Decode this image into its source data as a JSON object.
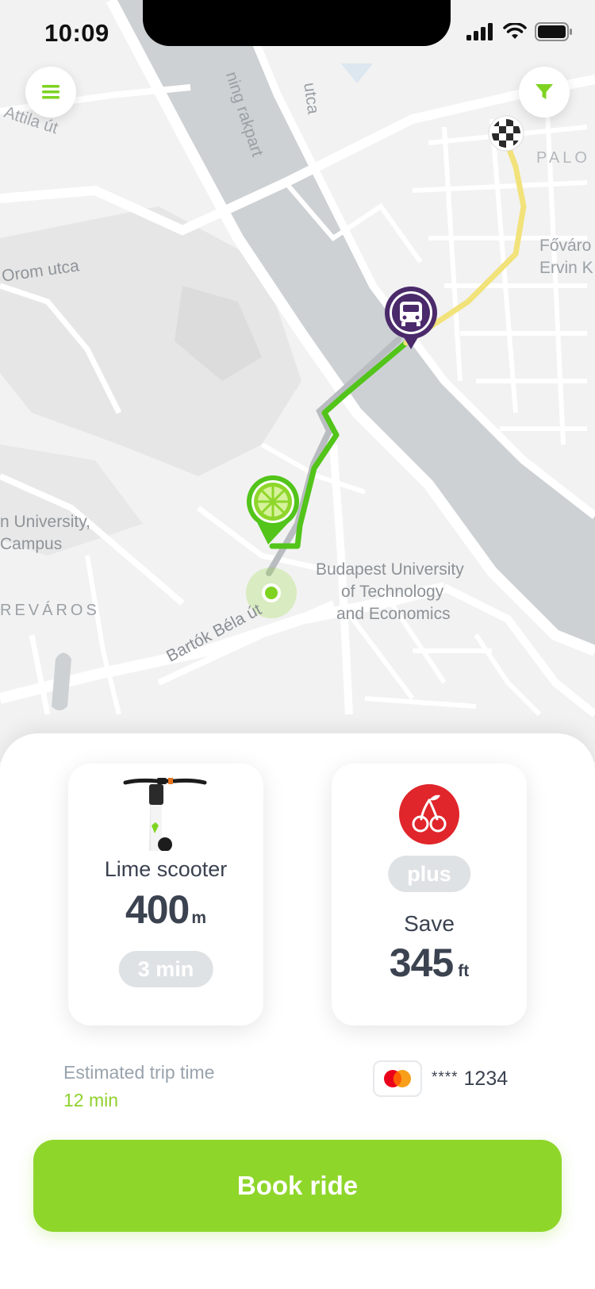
{
  "status_bar": {
    "time": "10:09"
  },
  "map": {
    "street_labels": {
      "attila": "Attila út",
      "rakpart": "ning rakpart",
      "utca_top": "utca",
      "orom": "Orom utca",
      "bartok": "Bartók Béla út",
      "palo": "PALO",
      "fovaro_1": "Főváro",
      "fovaro_2": "Ervin K",
      "university_left_1": "n University,",
      "university_left_2": "Campus",
      "district": "REVÁROS",
      "bme_1": "Budapest University",
      "bme_2": "of Technology",
      "bme_3": "and Economics"
    },
    "icons": {
      "menu": "menu-icon",
      "filter": "filter-icon",
      "destination": "checkered-flag-icon",
      "bus_stop": "bus-icon",
      "scooter_pin": "lime-icon"
    },
    "colors": {
      "route_green": "#52c41a",
      "route_yellow": "#f2e27a",
      "bus_purple": "#4b2a6b",
      "lime_green": "#7ed321"
    }
  },
  "scooter_card": {
    "name": "Lime scooter",
    "distance": "400",
    "distance_unit": "m",
    "time": "3 min"
  },
  "plus_card": {
    "badge": "plus",
    "save_label": "Save",
    "save_amount": "345",
    "save_unit": "ft",
    "icon": "cherry-icon",
    "icon_color": "#e0262b"
  },
  "trip": {
    "label": "Estimated trip time",
    "value": "12 min"
  },
  "payment": {
    "card_icon": "mastercard-icon",
    "mask": "****",
    "last4": "1234"
  },
  "book_button": {
    "label": "Book ride",
    "color": "#8fd62b"
  }
}
